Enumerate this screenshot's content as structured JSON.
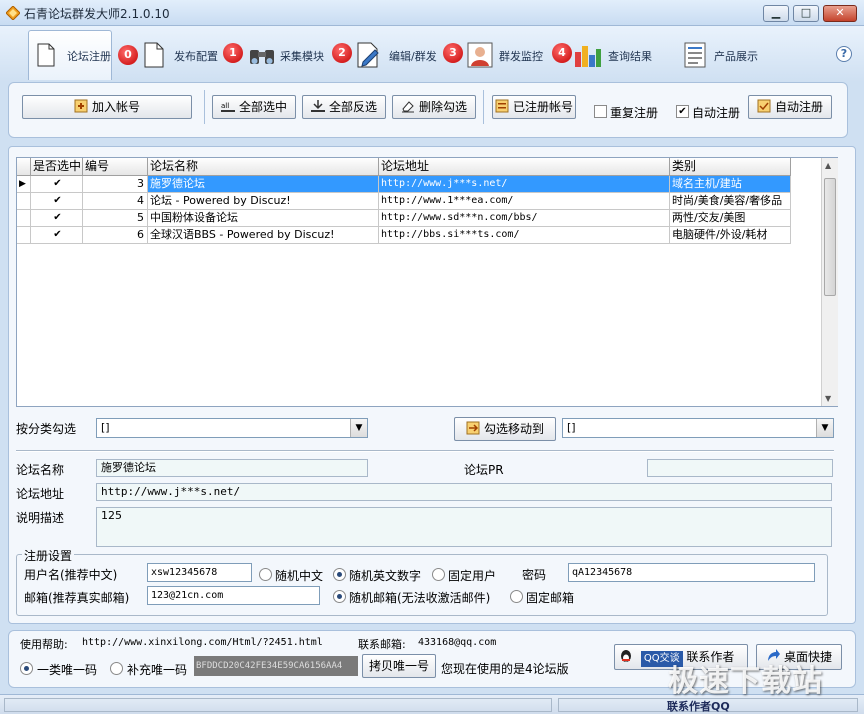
{
  "window": {
    "title": "石青论坛群发大师2.1.0.10",
    "btn_min": "▁",
    "btn_max": "□",
    "btn_close": "✕"
  },
  "tabs": [
    {
      "label": "论坛注册",
      "badge": "0"
    },
    {
      "label": "发布配置",
      "badge": "1"
    },
    {
      "label": "采集模块",
      "badge": "2"
    },
    {
      "label": "编辑/群发",
      "badge": "3"
    },
    {
      "label": "群发监控",
      "badge": "4"
    },
    {
      "label": "查询结果"
    },
    {
      "label": "产品展示"
    }
  ],
  "help_icon": "?",
  "actions": {
    "add_account": "加入帐号",
    "select_all": "全部选中",
    "invert_select": "全部反选",
    "delete_checked": "删除勾选",
    "registered_accounts": "已注册帐号",
    "repeat_register": "重复注册",
    "auto_register_chk": "自动注册",
    "auto_register_btn": "自动注册"
  },
  "grid": {
    "columns": [
      "是否选中",
      "编号",
      "论坛名称",
      "论坛地址",
      "类别"
    ],
    "rows": [
      {
        "checked": "✔",
        "id": "3",
        "name": "施罗德论坛",
        "url": "http://www.j***s.net/",
        "category": "域名主机/建站"
      },
      {
        "checked": "✔",
        "id": "4",
        "name": "论坛 -  Powered by Discuz!",
        "url": "http://www.1***ea.com/",
        "category": "时尚/美食/美容/奢侈品"
      },
      {
        "checked": "✔",
        "id": "5",
        "name": "中国粉体设备论坛",
        "url": "http://www.sd***n.com/bbs/",
        "category": "两性/交友/美图"
      },
      {
        "checked": "✔",
        "id": "6",
        "name": " 全球汉语BBS  - Powered by Discuz!",
        "url": "http://bbs.si***ts.com/",
        "category": "电脑硬件/外设/耗材"
      }
    ]
  },
  "filter": {
    "by_category_label": "按分类勾选",
    "by_category_value": "[]",
    "move_button": "勾选移动到",
    "move_target_value": "[]"
  },
  "detail": {
    "name_label": "论坛名称",
    "name_value": "施罗德论坛",
    "pr_label": "论坛PR",
    "pr_value": "",
    "url_label": "论坛地址",
    "url_value": "http://www.j***s.net/",
    "desc_label": "说明描述",
    "desc_value": "125"
  },
  "register": {
    "group_title": "注册设置",
    "username_label": "用户名(推荐中文)",
    "username_value": "xsw12345678",
    "opt_random_cn": "随机中文",
    "opt_random_en": "随机英文数字",
    "opt_fixed_user": "固定用户",
    "password_label": "密码",
    "password_value": "qA12345678",
    "email_label": "邮箱(推荐真实邮箱)",
    "email_value": "123@21cn.com",
    "opt_random_email": "随机邮箱(无法收激活邮件)",
    "opt_fixed_email": "固定邮箱"
  },
  "footer": {
    "help_label": "使用帮助:",
    "help_url": "http://www.xinxilong.com/Html/?2451.html",
    "email_label": "联系邮箱:",
    "email_value": "433168@qq.com",
    "code_type_1": "一类唯一码",
    "code_type_2": "补充唯一码",
    "machine_code": "BFDDCD20C42FE34E59CA6156AA4",
    "copy_button": "拷贝唯一号",
    "version_text": "您现在使用的是4论坛版",
    "qq_chat": "QQ交谈",
    "contact_author": "联系作者",
    "desktop_shortcut": "桌面快捷",
    "status_text": "联系作者QQ",
    "watermark": "极速下载站"
  },
  "colors": {
    "accent": "#3399ff",
    "badge": "#c40000",
    "frame": "#cfe0f2"
  }
}
